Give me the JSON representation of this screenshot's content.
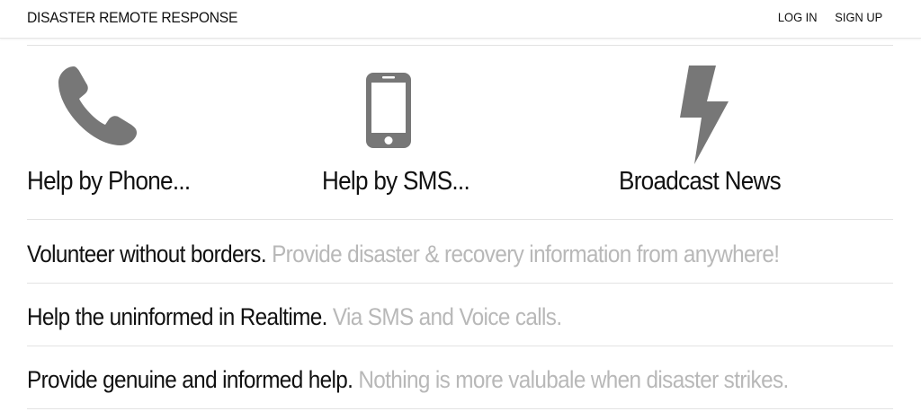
{
  "nav": {
    "brand": "DISASTER REMOTE RESPONSE",
    "links": [
      "LOG IN",
      "SIGN UP"
    ]
  },
  "features": [
    {
      "icon": "phone-icon",
      "title": "Help by Phone..."
    },
    {
      "icon": "mobile-phone-icon",
      "title": "Help by SMS..."
    },
    {
      "icon": "lightning-bolt-icon",
      "title": "Broadcast News"
    }
  ],
  "rows": [
    {
      "lead": "Volunteer without borders.",
      "detail": "Provide disaster & recovery information from anywhere!"
    },
    {
      "lead": "Help the uninformed in Realtime.",
      "detail": "Via SMS and Voice calls."
    },
    {
      "lead": "Provide genuine and informed help.",
      "detail": "Nothing is more valubale when disaster strikes."
    }
  ],
  "colors": {
    "icon": "#777777",
    "text": "#111111",
    "muted": "#b8b8b8",
    "rule": "#e3e3e3"
  }
}
